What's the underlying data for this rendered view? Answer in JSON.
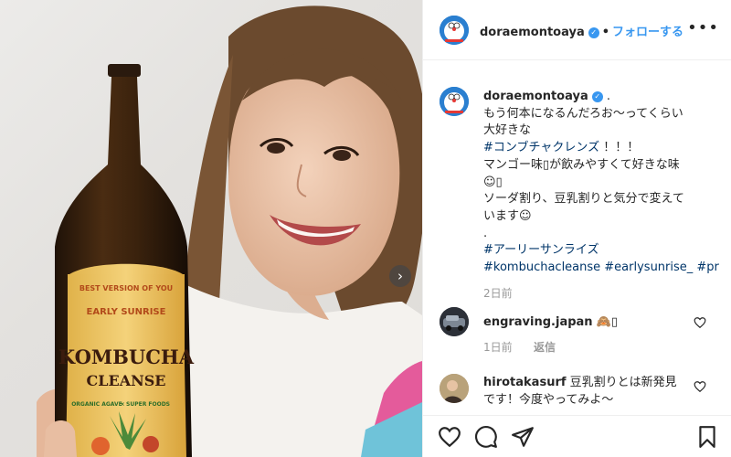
{
  "post": {
    "username": "doraemontoaya",
    "follow_label": "フォローする",
    "more_label": "•••",
    "next_arrow": "›",
    "bottle_label": {
      "arc_text": "BEST VERSION OF YOU",
      "brand": "EARLY SUNRISE",
      "title1": "KOMBUCHA",
      "title2": "CLEANSE",
      "sub1": "ORGANIC AGAVE",
      "sub_sep": "×",
      "sub2": "SUPER FOODS"
    }
  },
  "caption": {
    "username": "doraemontoaya",
    "lines": [
      "もう何本になるんだろお〜ってくらい",
      "大好きな",
      "#コンブチャクレンズ ！！！",
      "マンゴー味▯が飲みやすくて好きな味",
      "☺︎▯",
      "ソーダ割り、豆乳割りと気分で変えて",
      "います☺︎",
      ".",
      "#アーリーサンライズ",
      "#kombuchacleanse #earlysunrise_ #pr"
    ],
    "hashtag_line_1": "#コンブチャクレンズ",
    "hashtag_line_1_rest": " ！！！",
    "hashtag_line_9": "#アーリーサンライズ",
    "hashtag_line_10": "#kombuchacleanse #earlysunrise_ #pr",
    "date": "2日前"
  },
  "comments": [
    {
      "username": "engraving.japan",
      "text": "🙈▯",
      "date": "1日前",
      "reply_label": "返信"
    },
    {
      "username": "hirotakasurf",
      "text_line1": "豆乳割りとは新発見",
      "text_line2": "です！今度やってみよ〜"
    }
  ],
  "actions": [
    "heart-icon",
    "comment-icon",
    "share-icon",
    "bookmark-icon"
  ],
  "colors": {
    "link": "#3897f0",
    "hashtag": "#003569",
    "muted": "#999999",
    "verified": "#3897f0"
  }
}
